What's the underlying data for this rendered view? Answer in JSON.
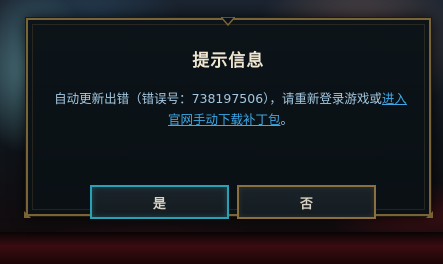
{
  "dialog": {
    "title": "提示信息",
    "message_prefix": "自动更新出错（错误号：738197506），请重新登录游戏或",
    "link_text": "进入官网手动下载补丁包",
    "message_suffix": "。",
    "yes_label": "是",
    "no_label": "否"
  },
  "colors": {
    "border_gold": "#7a6436",
    "yes_border": "#2aa0b5",
    "no_border": "#8a7040",
    "title_text": "#f0e6d2",
    "message_text": "#a3c7e0",
    "link_text": "#3fa7e6"
  }
}
